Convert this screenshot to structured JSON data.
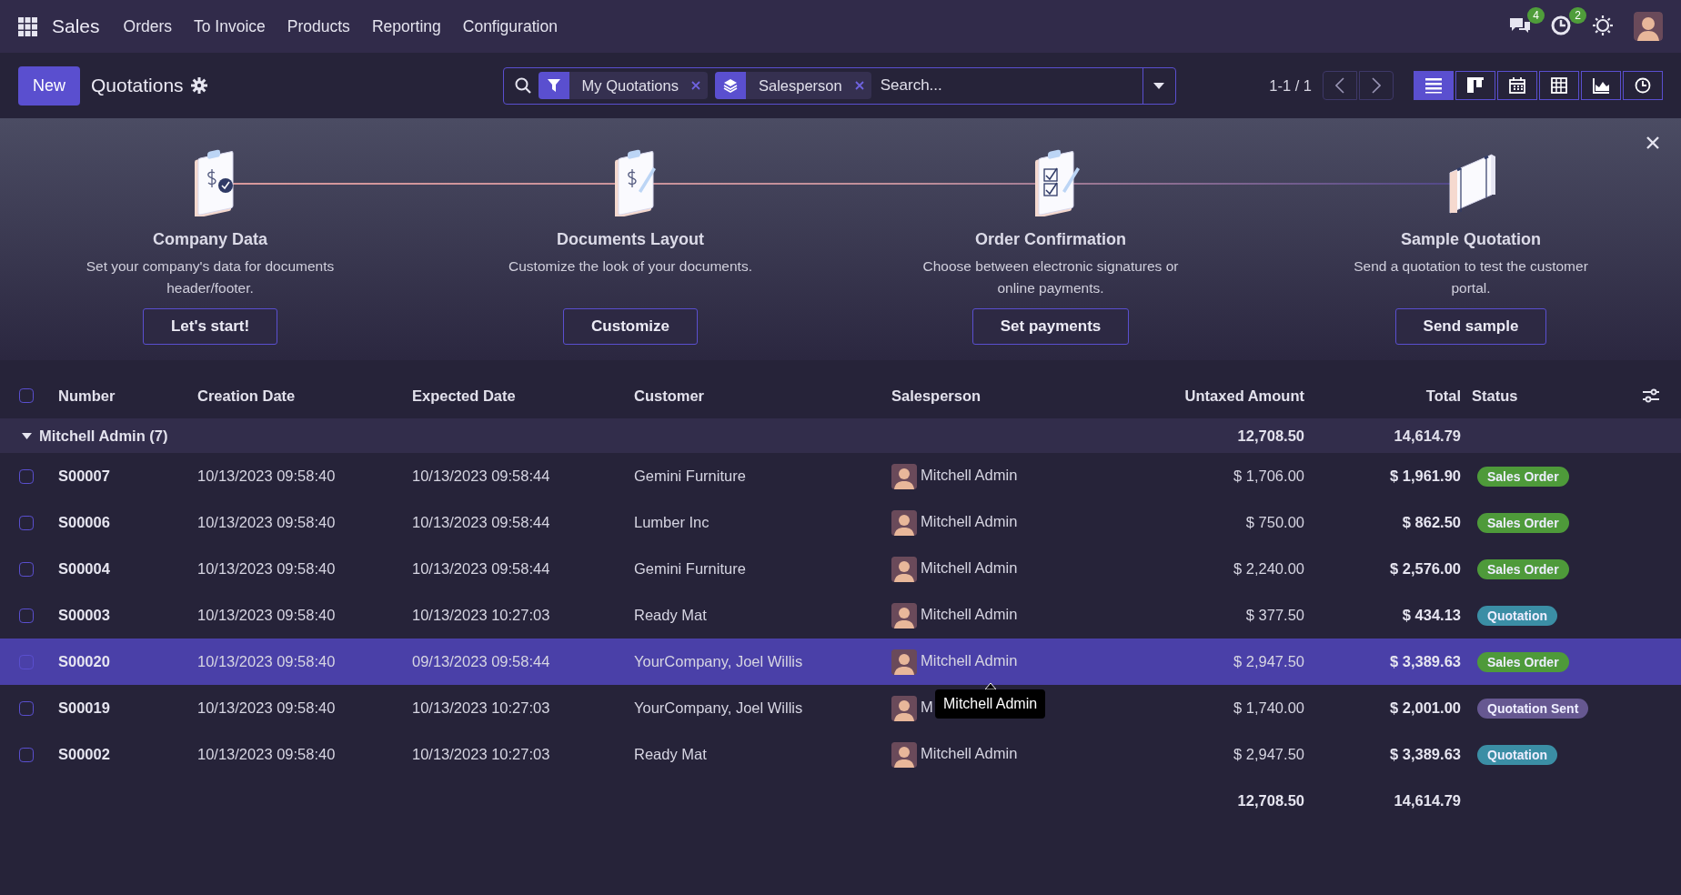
{
  "navbar": {
    "app": "Sales",
    "menu": [
      "Orders",
      "To Invoice",
      "Products",
      "Reporting",
      "Configuration"
    ],
    "notifications": [
      {
        "kind": "chat",
        "count": "4"
      },
      {
        "kind": "activity",
        "count": "2"
      }
    ]
  },
  "control_panel": {
    "new_button": "New",
    "title": "Quotations",
    "facets": [
      {
        "kind": "filter",
        "label": "My Quotations"
      },
      {
        "kind": "group",
        "label": "Salesperson"
      }
    ],
    "search_placeholder": "Search...",
    "pager": "1-1 / 1",
    "views": [
      {
        "kind": "list",
        "selected": true
      },
      {
        "kind": "kanban",
        "selected": false
      },
      {
        "kind": "calendar",
        "selected": false
      },
      {
        "kind": "pivot",
        "selected": false
      },
      {
        "kind": "graph",
        "selected": false
      },
      {
        "kind": "activity",
        "selected": false
      }
    ]
  },
  "onboarding": {
    "steps": [
      {
        "kind": "company",
        "title": "Company Data",
        "description": "Set your company's data for documents header/footer.",
        "button": "Let's start!"
      },
      {
        "kind": "layout",
        "title": "Documents Layout",
        "description": "Customize the look of your documents.",
        "button": "Customize"
      },
      {
        "kind": "confirmation",
        "title": "Order Confirmation",
        "description": "Choose between electronic signatures or online payments.",
        "button": "Set payments"
      },
      {
        "kind": "sample",
        "title": "Sample Quotation",
        "description": "Send a quotation to test the customer portal.",
        "button": "Send sample"
      }
    ]
  },
  "table": {
    "select_all_checked": false,
    "columns": [
      "Number",
      "Creation Date",
      "Expected Date",
      "Customer",
      "Salesperson",
      "Untaxed Amount",
      "Total",
      "Status"
    ],
    "group": {
      "label": "Mitchell Admin (7)",
      "expanded": true,
      "untaxed": "12,708.50",
      "total": "14,614.79"
    },
    "rows": [
      {
        "number": "S00007",
        "created": "10/13/2023 09:58:40",
        "expected": "10/13/2023 09:58:44",
        "customer": "Gemini Furniture",
        "salesperson": "Mitchell Admin",
        "untaxed": "$ 1,706.00",
        "total": "$ 1,961.90",
        "status": {
          "label": "Sales Order",
          "color": "#4e9a3a"
        },
        "checked": false,
        "highlighted": false
      },
      {
        "number": "S00006",
        "created": "10/13/2023 09:58:40",
        "expected": "10/13/2023 09:58:44",
        "customer": "Lumber Inc",
        "salesperson": "Mitchell Admin",
        "untaxed": "$ 750.00",
        "total": "$ 862.50",
        "status": {
          "label": "Sales Order",
          "color": "#4e9a3a"
        },
        "checked": false,
        "highlighted": false
      },
      {
        "number": "S00004",
        "created": "10/13/2023 09:58:40",
        "expected": "10/13/2023 09:58:44",
        "customer": "Gemini Furniture",
        "salesperson": "Mitchell Admin",
        "untaxed": "$ 2,240.00",
        "total": "$ 2,576.00",
        "status": {
          "label": "Sales Order",
          "color": "#4e9a3a"
        },
        "checked": false,
        "highlighted": false
      },
      {
        "number": "S00003",
        "created": "10/13/2023 09:58:40",
        "expected": "10/13/2023 10:27:03",
        "customer": "Ready Mat",
        "salesperson": "Mitchell Admin",
        "untaxed": "$ 377.50",
        "total": "$ 434.13",
        "status": {
          "label": "Quotation",
          "color": "#3b8ea5"
        },
        "checked": false,
        "highlighted": false
      },
      {
        "number": "S00020",
        "created": "10/13/2023 09:58:40",
        "expected": "09/13/2023 09:58:44",
        "customer": "YourCompany, Joel Willis",
        "salesperson": "Mitchell Admin",
        "untaxed": "$ 2,947.50",
        "total": "$ 3,389.63",
        "status": {
          "label": "Sales Order",
          "color": "#4e9a3a"
        },
        "checked": false,
        "highlighted": true,
        "tooltip": "Mitchell Admin"
      },
      {
        "number": "S00019",
        "created": "10/13/2023 09:58:40",
        "expected": "10/13/2023 10:27:03",
        "customer": "YourCompany, Joel Willis",
        "salesperson": "M",
        "untaxed": "$ 1,740.00",
        "total": "$ 2,001.00",
        "status": {
          "label": "Quotation Sent",
          "color": "#665891"
        },
        "checked": false,
        "highlighted": false
      },
      {
        "number": "S00002",
        "created": "10/13/2023 09:58:40",
        "expected": "10/13/2023 10:27:03",
        "customer": "Ready Mat",
        "salesperson": "Mitchell Admin",
        "untaxed": "$ 2,947.50",
        "total": "$ 3,389.63",
        "status": {
          "label": "Quotation",
          "color": "#3b8ea5"
        },
        "checked": false,
        "highlighted": false
      }
    ],
    "totals": {
      "untaxed": "12,708.50",
      "total": "14,614.79"
    }
  }
}
